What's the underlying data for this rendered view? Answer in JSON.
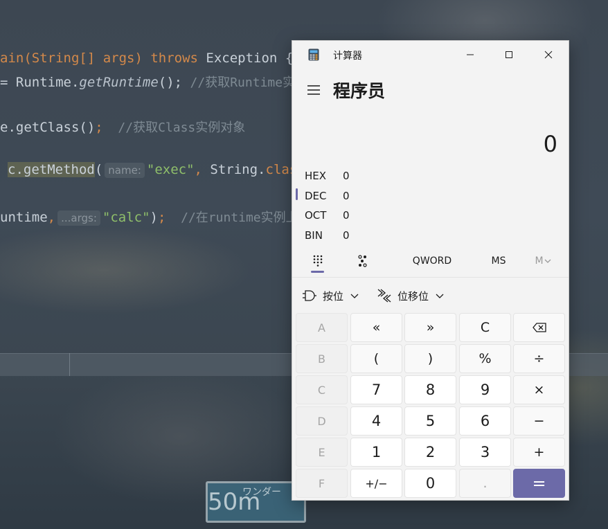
{
  "ide": {
    "line1": {
      "a": "ain(String[] args) ",
      "kw": "throws",
      "b": " Exception {"
    },
    "line2": {
      "a": "= Runtime.",
      "method": "getRuntime",
      "b": "(); ",
      "comment": "//获取Runtime实"
    },
    "line3": {
      "a": "e.getClass()",
      "semi": ";",
      "comment": "  //获取Class实例对象"
    },
    "line4": {
      "hl": "c.getMethod",
      "a": "(",
      "hint": "name:",
      "str": "\"exec\"",
      "comma": ",",
      "b": " String.",
      "kw": "clas"
    },
    "line5": {
      "a": "untime",
      "comma": ",",
      "hint": "...args:",
      "str": "\"calc\"",
      "b": ")",
      "semi": ";",
      "comment": "  //在runtime实例上"
    }
  },
  "wallpaper": {
    "sign_text": "50m",
    "sign_sub": "ワンダー"
  },
  "calculator": {
    "window_title": "计算器",
    "mode_title": "程序员",
    "display_value": "0",
    "radix": [
      {
        "label": "HEX",
        "value": "0"
      },
      {
        "label": "DEC",
        "value": "0"
      },
      {
        "label": "OCT",
        "value": "0"
      },
      {
        "label": "BIN",
        "value": "0"
      }
    ],
    "toolbar": {
      "word_size": "QWORD",
      "ms": "MS",
      "mlist": "M"
    },
    "ops": {
      "bitwise": "按位",
      "shift": "位移位"
    },
    "keys": {
      "hex_a": "A",
      "hex_b": "B",
      "hex_c": "C",
      "hex_d": "D",
      "hex_e": "E",
      "hex_f": "F",
      "lshift": "«",
      "rshift": "»",
      "clear": "C",
      "lparen": "(",
      "rparen": ")",
      "mod": "%",
      "divide": "÷",
      "n7": "7",
      "n8": "8",
      "n9": "9",
      "multiply": "×",
      "n4": "4",
      "n5": "5",
      "n6": "6",
      "minus": "−",
      "n1": "1",
      "n2": "2",
      "n3": "3",
      "plus": "+",
      "negate": "+/−",
      "n0": "0",
      "decimal": ".",
      "equals": "="
    },
    "colors": {
      "accent": "#6c6aa8",
      "window_bg": "#f3f3f3"
    }
  }
}
